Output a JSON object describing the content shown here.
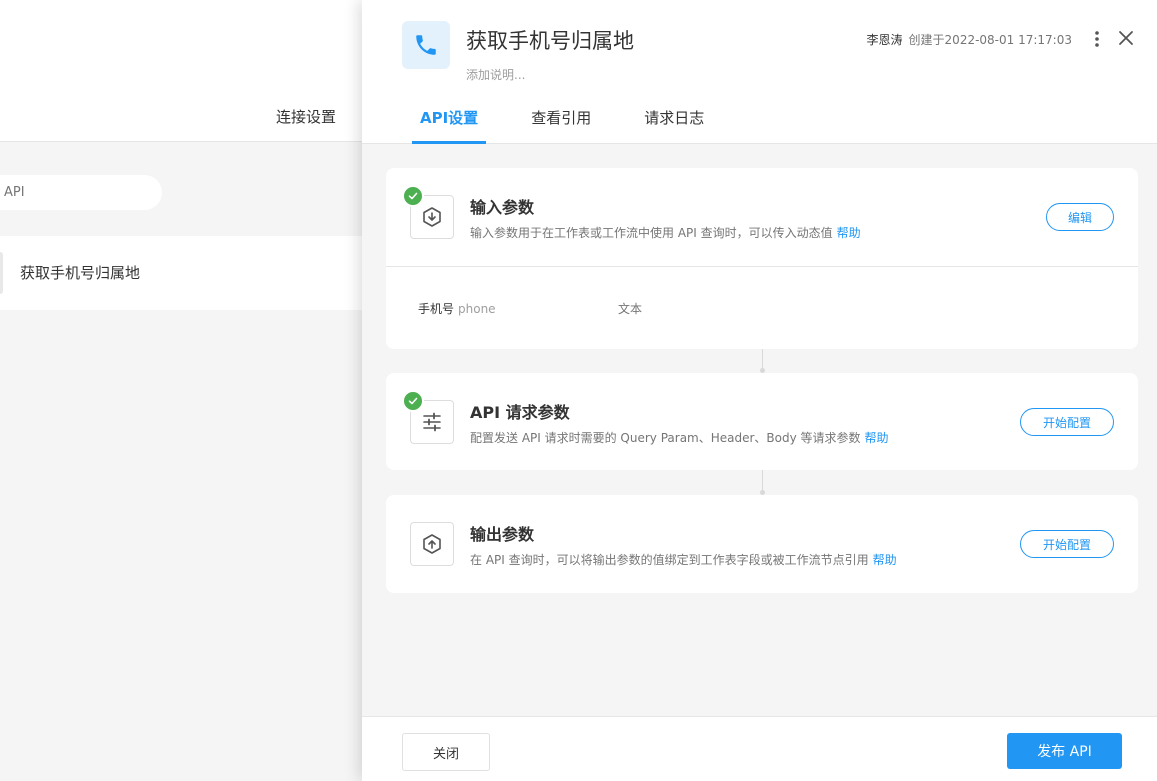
{
  "background": {
    "connection_settings_label": "连接设置",
    "search_text": "API",
    "list_item_label": "获取手机号归属地"
  },
  "drawer": {
    "title": "获取手机号归属地",
    "description_placeholder": "添加说明...",
    "creator": "李恩涛",
    "created_text": "创建于2022-08-01 17:17:03",
    "tabs": [
      {
        "label": "API设置",
        "active": true
      },
      {
        "label": "查看引用",
        "active": false
      },
      {
        "label": "请求日志",
        "active": false
      }
    ],
    "cards": {
      "input": {
        "title": "输入参数",
        "desc": "输入参数用于在工作表或工作流中使用 API 查询时，可以传入动态值",
        "help": "帮助",
        "button": "编辑",
        "completed": true,
        "params": [
          {
            "name": "手机号",
            "code": "phone",
            "type": "文本"
          }
        ]
      },
      "request": {
        "title": "API 请求参数",
        "desc": "配置发送 API 请求时需要的 Query Param、Header、Body 等请求参数",
        "help": "帮助",
        "button": "开始配置",
        "completed": true
      },
      "output": {
        "title": "输出参数",
        "desc": "在 API 查询时，可以将输出参数的值绑定到工作表字段或被工作流节点引用",
        "help": "帮助",
        "button": "开始配置",
        "completed": false
      }
    },
    "footer": {
      "close_label": "关闭",
      "publish_label": "发布 API"
    }
  },
  "colors": {
    "accent": "#2196f3",
    "success": "#4caf50",
    "icon_bg": "#e3f1fd"
  }
}
